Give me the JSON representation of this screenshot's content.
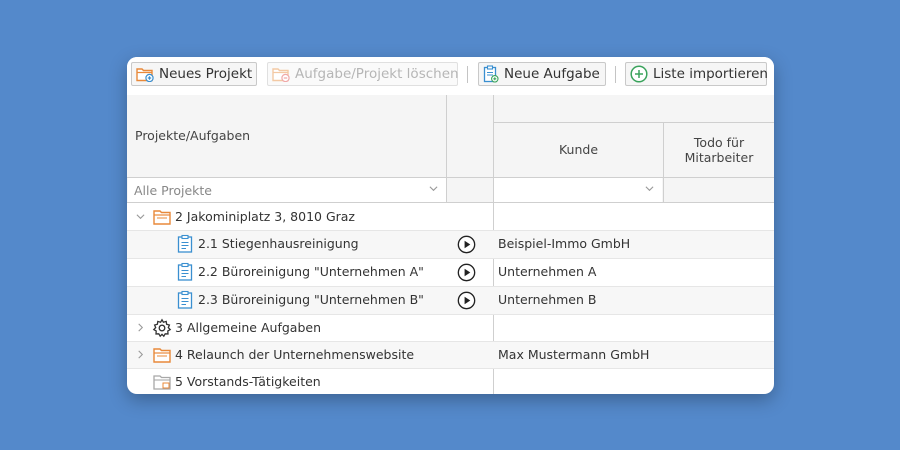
{
  "toolbar": {
    "new_project": "Neues Projekt",
    "delete": "Aufgabe/Projekt löschen",
    "new_task": "Neue Aufgabe",
    "import_list": "Liste importieren"
  },
  "columns": {
    "projects": "Projekte/Aufgaben",
    "customer": "Kunde",
    "todo": "Todo für Mitarbeiter"
  },
  "filters": {
    "projects_value": "Alle Projekte",
    "customer_value": ""
  },
  "rows": [
    {
      "label": "2 Jakominiplatz 3, 8010 Graz",
      "customer": "",
      "icon": "folder-icon",
      "expanded": true
    },
    {
      "label": "2.1 Stiegenhausreinigung",
      "customer": "Beispiel-Immo GmbH",
      "icon": "clipboard-icon"
    },
    {
      "label": "2.2 Büroreinigung \"Unternehmen A\"",
      "customer": "Unternehmen A",
      "icon": "clipboard-icon"
    },
    {
      "label": "2.3 Büroreinigung \"Unternehmen B\"",
      "customer": "Unternehmen B",
      "icon": "clipboard-icon"
    },
    {
      "label": "3 Allgemeine Aufgaben",
      "customer": "",
      "icon": "gear-icon",
      "expanded": false
    },
    {
      "label": "4 Relaunch der Unternehmenswebsite",
      "customer": "Max Mustermann GmbH",
      "icon": "folder-icon",
      "expanded": false
    },
    {
      "label": "5 Vorstands-Tätigkeiten",
      "customer": "",
      "icon": "folder-gray-icon"
    }
  ],
  "colors": {
    "background": "#5489cb",
    "folder_orange": "#e8893a",
    "task_blue": "#3a8fd0",
    "import_green": "#3aa35c"
  }
}
